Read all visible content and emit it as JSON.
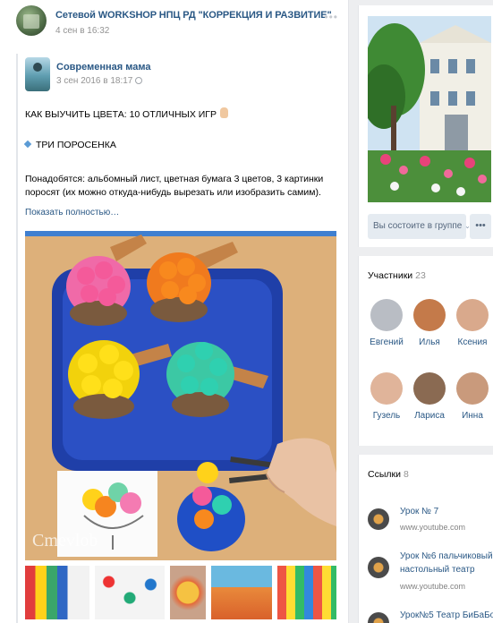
{
  "post": {
    "group_name": "Сетевой WORKSHOP НПЦ РД \"КОРРЕКЦИЯ И РАЗВИТИЕ\"",
    "date": "4 сен в 16:32",
    "more_dots": "•••"
  },
  "repost": {
    "author": "Современная мама",
    "date": "3 сен 2016 в 18:17",
    "title": "КАК ВЫУЧИТЬ ЦВЕТА: 10 ОТЛИЧНЫХ ИГР",
    "game": "ТРИ ПОРОСЕНКА",
    "body": "Понадобятся: альбомный лист, цветная бумага 3 цветов, 3 картинки поросят (их можно откуда-нибудь вырезать или изобразить самим).",
    "show_more": "Показать полностью…"
  },
  "sidebar": {
    "join_label": "Вы состоите в группе",
    "more_label": "•••",
    "members_title": "Участники",
    "members_count": "23",
    "members": [
      {
        "name": "Евгений",
        "color": "#b9bdc4"
      },
      {
        "name": "Илья",
        "color": "#c47a4a"
      },
      {
        "name": "Ксения",
        "color": "#d9a98c"
      },
      {
        "name": "Гузель",
        "color": "#e0b49a"
      },
      {
        "name": "Лариса",
        "color": "#8a6a52"
      },
      {
        "name": "Инна",
        "color": "#c99a7c"
      }
    ],
    "links_title": "Ссылки",
    "links_count": "8",
    "links": [
      {
        "title": "Урок № 7",
        "url": "www.youtube.com"
      },
      {
        "title": "Урок №6 пальчиковый настольный театр",
        "url": "www.youtube.com"
      },
      {
        "title": "Урок№5 Театр БиБаБо",
        "url": ""
      }
    ]
  },
  "colors": {
    "link": "#2a5885",
    "meta": "#939393",
    "button_bg": "#e5ebf1"
  }
}
